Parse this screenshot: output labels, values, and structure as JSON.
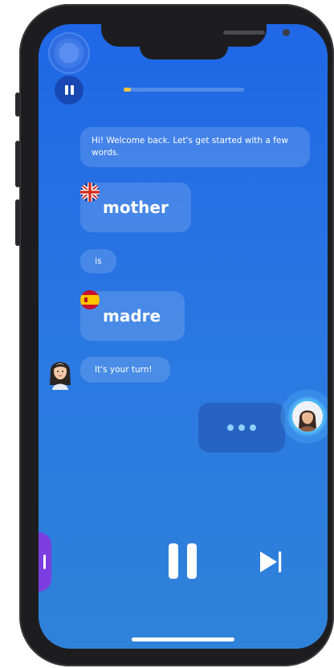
{
  "chat": {
    "greeting": "Hi! Welcome back. Let's get started with a few words.",
    "word_source": "mother",
    "connector": "is",
    "word_target": "madre",
    "prompt": "It's your turn!"
  },
  "lesson": {
    "progress_fraction": 0.06
  },
  "flags": {
    "source": "uk-flag-icon",
    "target": "spain-flag-icon"
  },
  "icons": {
    "mini_pause": "pause-icon",
    "big_pause": "pause-icon",
    "skip": "skip-forward-icon",
    "typing": "typing-dots-icon"
  },
  "colors": {
    "screen_top": "#1f67e6",
    "screen_bottom": "#2f82d9",
    "progress_fill": "#f6c340",
    "side_tab": "#7c3ee0",
    "typing_dots": "#8fd0ff"
  }
}
